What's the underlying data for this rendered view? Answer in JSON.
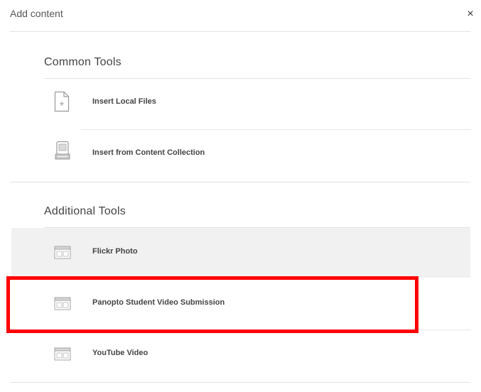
{
  "dialog": {
    "title": "Add content",
    "close_glyph": "×"
  },
  "sections": [
    {
      "title": "Common Tools",
      "items": [
        {
          "label": "Insert Local Files",
          "icon": "file-icon"
        },
        {
          "label": "Insert from Content Collection",
          "icon": "content-collection-icon"
        }
      ]
    },
    {
      "title": "Additional Tools",
      "items": [
        {
          "label": "Flickr Photo",
          "icon": "tool-window-icon"
        },
        {
          "label": "Panopto Student Video Submission",
          "icon": "tool-window-icon"
        },
        {
          "label": "YouTube Video",
          "icon": "tool-window-icon"
        }
      ]
    }
  ],
  "colors": {
    "highlight": "#ff0000",
    "hover_row": "#f1f1f1",
    "divider": "#e2e2e2"
  }
}
